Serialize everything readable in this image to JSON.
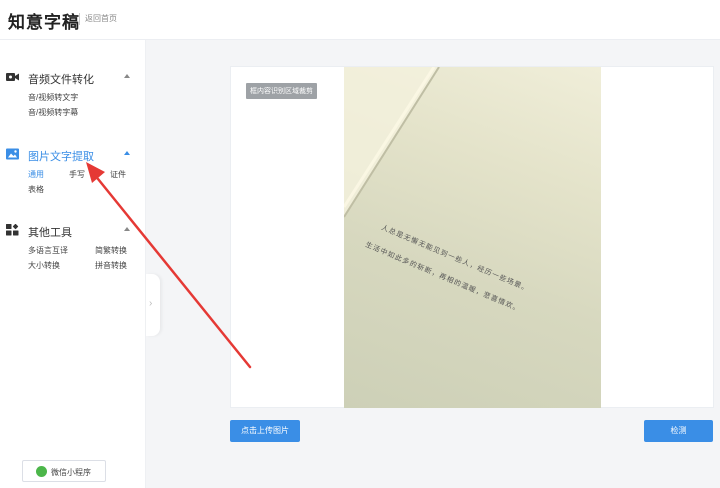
{
  "header": {
    "logo": "知意字稿",
    "back_link": "返回首页"
  },
  "sidebar": {
    "sections": [
      {
        "title": "音频文件转化",
        "icon": "video-icon",
        "items": [
          "音/视频转文字",
          "音/视频转字幕"
        ]
      },
      {
        "title": "图片文字提取",
        "icon": "image-icon",
        "items": [
          "通用",
          "手写",
          "证件",
          "表格"
        ],
        "selected_item": "通用"
      },
      {
        "title": "其他工具",
        "icon": "grid-icon",
        "items": [
          "多语言互译",
          "简繁转换",
          "大小转换",
          "拼音转换"
        ]
      }
    ],
    "wechat_label": "微信小程序"
  },
  "preview": {
    "region_badge": "框内容识别区域裁剪",
    "photo_lines": [
      "人总是无懈无能见到一些人，经历一些场景。",
      "生活中如此多的斩断，再相的温暖，悲喜情欢。"
    ]
  },
  "actions": {
    "upload_label": "点击上传图片",
    "detect_label": "检测"
  },
  "colors": {
    "accent": "#3a8ee6",
    "annotation_arrow": "#e53935",
    "wechat_green": "#4cb64a"
  }
}
